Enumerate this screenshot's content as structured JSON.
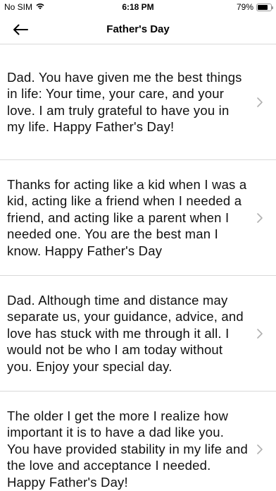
{
  "status": {
    "carrier": "No SIM",
    "time": "6:18 PM",
    "battery_text": "79%",
    "battery_level": 0.79
  },
  "nav": {
    "title": "Father's Day"
  },
  "quotes": [
    {
      "text": "Dad. You have given me the best things in life: Your time, your care, and your love. I am truly grateful to have you in my life. Happy Father's Day!"
    },
    {
      "text": "Thanks for acting like a kid when I was a kid, acting like a friend when I needed a friend, and acting like a parent when I needed one. You are the best man I know. Happy Father's Day"
    },
    {
      "text": "Dad. Although time and distance may separate us, your guidance, advice, and love has stuck with me through it all. I would not be who I am today without you. Enjoy your special day."
    },
    {
      "text": "The older I get the more I realize how important it is to have a dad like you. You have provided stability in my life and the love and acceptance I needed. Happy Father's Day!"
    }
  ],
  "icons": {
    "wifi": "wifi-icon",
    "battery": "battery-icon",
    "back": "arrow-left-icon",
    "chevron": "chevron-right-icon"
  }
}
